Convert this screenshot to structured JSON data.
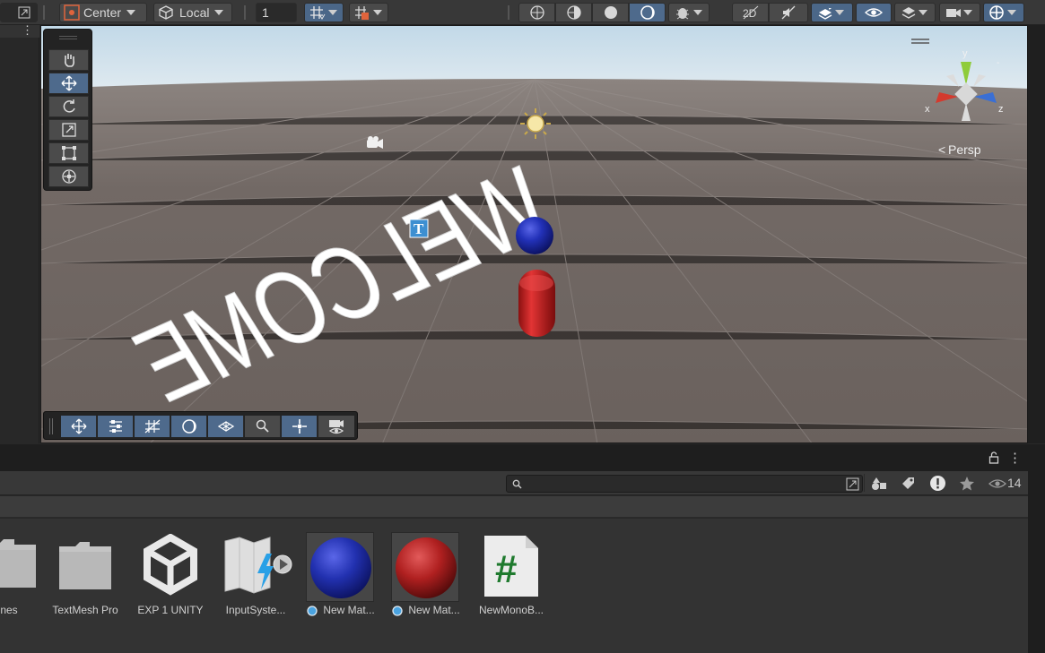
{
  "toolbar": {
    "pivot_label": "Center",
    "space_label": "Local",
    "grid_value": "1"
  },
  "scene": {
    "welcome_text": "WELCOME",
    "persp_label": "Persp",
    "axis_x": "x",
    "axis_y": "y",
    "axis_z": "z"
  },
  "project": {
    "visible_count": "14",
    "search_placeholder": "",
    "assets": [
      {
        "label": "nes",
        "type": "folder"
      },
      {
        "label": "TextMesh Pro",
        "type": "folder"
      },
      {
        "label": "EXP 1 UNITY",
        "type": "unity-scene"
      },
      {
        "label": "InputSyste...",
        "type": "input-actions"
      },
      {
        "label": "New Mat...",
        "type": "material-blue"
      },
      {
        "label": "New Mat...",
        "type": "material-red"
      },
      {
        "label": "NewMonoB...",
        "type": "csharp-script"
      }
    ]
  },
  "colors": {
    "selected_blue": "#4e6a8c",
    "sky": "#cfe3ee",
    "ground": "#6e6561",
    "sphere_blue": "#1f2ba6",
    "capsule_red": "#c01c1c",
    "script_green": "#1f7a2e"
  }
}
